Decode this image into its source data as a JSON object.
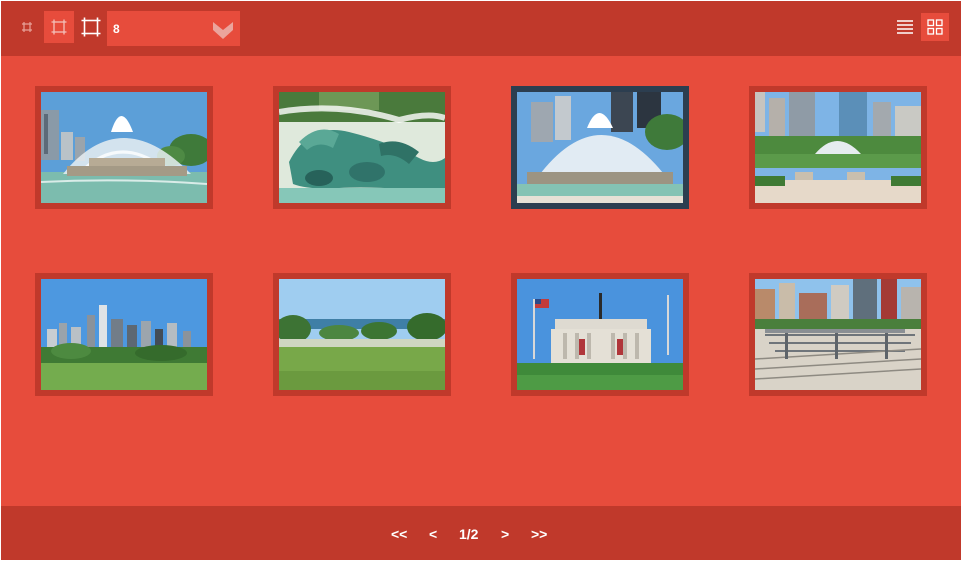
{
  "toolbar": {
    "thumb_sizes": [
      "small-thumbnail-size-icon",
      "medium-thumbnail-size-icon",
      "large-thumbnail-size-icon"
    ],
    "active_thumb_size": "medium",
    "per_page": {
      "value": "8",
      "icon": "chevron-down-icon"
    },
    "views": [
      "list-view-icon",
      "grid-view-icon"
    ],
    "active_view": "grid"
  },
  "gallery": {
    "items": [
      {
        "subject": "fountain-skyline",
        "selected": false
      },
      {
        "subject": "fountain-seahorse-sculpture",
        "selected": false
      },
      {
        "subject": "fountain-towers",
        "selected": true
      },
      {
        "subject": "garden-fountain-benches",
        "selected": false
      },
      {
        "subject": "city-skyline-park",
        "selected": false
      },
      {
        "subject": "lakefront-lawn",
        "selected": false
      },
      {
        "subject": "museum-facade",
        "selected": false
      },
      {
        "subject": "rail-yard-city",
        "selected": false
      }
    ]
  },
  "pager": {
    "first": "<<",
    "prev": "<",
    "indicator": "1/2",
    "next": ">",
    "last": ">>"
  },
  "colors": {
    "background": "#e74c3c",
    "bars": "#c0392b",
    "selected_frame": "#2c3e50",
    "text": "#ffffff"
  }
}
